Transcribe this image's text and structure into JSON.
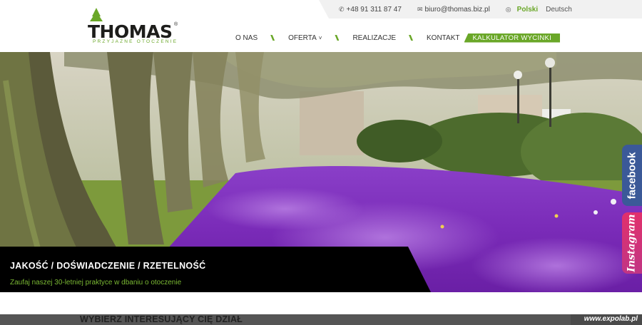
{
  "header": {
    "logo_text": "THOMAS",
    "logo_registered": "®",
    "logo_tagline": "PRZYJAZNE OTOCZENIE",
    "phone": "+48 91 311 87 47",
    "email": "biuro@thomas.biz.pl",
    "languages": {
      "active": "Polski",
      "other": "Deutsch"
    }
  },
  "nav": {
    "items": [
      "O NAS",
      "OFERTA",
      "REALIZACJE",
      "KONTAKT"
    ],
    "cta": "KALKULATOR WYCINKI"
  },
  "hero": {
    "headline": "JAKOŚĆ / DOŚWIADCZENIE / RZETELNOŚĆ",
    "subline": "Zaufaj naszej 30-letniej praktyce w dbaniu o otoczenie"
  },
  "social": {
    "facebook": "facebook",
    "instagram": "Instagram"
  },
  "section": {
    "title": "WYBIERZ INTERESUJĄCY CIĘ DZIAŁ"
  },
  "watermark": "www.expolab.pl",
  "colors": {
    "brand_green": "#6aa728",
    "facebook": "#3b5998",
    "instagram": "#e1306c",
    "caption_bg": "#000000"
  },
  "icons": {
    "phone": "phone-icon",
    "email": "envelope-icon",
    "language": "globe-icon",
    "dropdown": "chevron-down-icon"
  }
}
